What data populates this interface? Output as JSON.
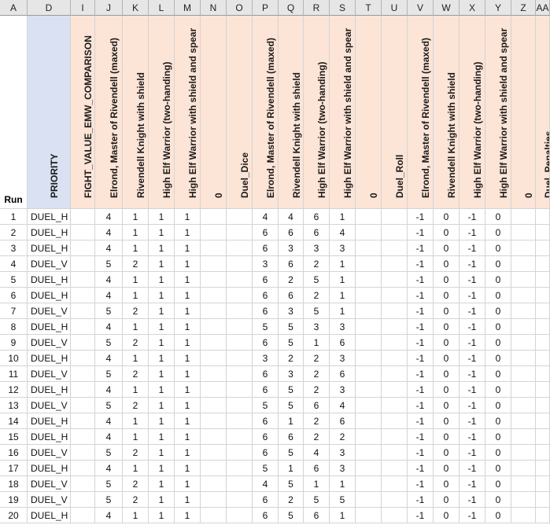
{
  "columns": [
    "A",
    "D",
    "I",
    "J",
    "K",
    "L",
    "M",
    "N",
    "O",
    "P",
    "Q",
    "R",
    "S",
    "T",
    "U",
    "V",
    "W",
    "X",
    "Y",
    "Z",
    "AA"
  ],
  "header_row": {
    "run": "Run",
    "labels": [
      "",
      "PRIORITY",
      "FIGHT_VALUE_EMW_COMPARISON",
      "Elrond, Master of Rivendell (maxed)",
      "Rivendell Knight with shield",
      "High Elf Warrior (two-handing)",
      "High Elf Warrior with shield and spear",
      "0",
      "Duel_Dice",
      "Elrond, Master of Rivendell (maxed)",
      "Rivendell Knight with shield",
      "High Elf Warrior (two-handing)",
      "High Elf Warrior with shield and spear",
      "0",
      "Duel_Roll",
      "Elrond, Master of Rivendell (maxed)",
      "Rivendell Knight with shield",
      "High Elf Warrior (two-handing)",
      "High Elf Warrior with shield and spear",
      "0",
      "Duel_Penalties"
    ]
  },
  "colors": {
    "header_peach": "#fce4d6",
    "header_blue": "#d9e1f2",
    "header_white": "#ffffff",
    "grid": "#d4d4d4",
    "col_header_bg": "#e6e6e6"
  },
  "rows": [
    [
      "1",
      "DUEL_H",
      "",
      "4",
      "1",
      "1",
      "1",
      "",
      "",
      "4",
      "4",
      "6",
      "1",
      "",
      "",
      "-1",
      "0",
      "-1",
      "0",
      "",
      ""
    ],
    [
      "2",
      "DUEL_H",
      "",
      "4",
      "1",
      "1",
      "1",
      "",
      "",
      "6",
      "6",
      "6",
      "4",
      "",
      "",
      "-1",
      "0",
      "-1",
      "0",
      "",
      ""
    ],
    [
      "3",
      "DUEL_H",
      "",
      "4",
      "1",
      "1",
      "1",
      "",
      "",
      "6",
      "3",
      "3",
      "3",
      "",
      "",
      "-1",
      "0",
      "-1",
      "0",
      "",
      ""
    ],
    [
      "4",
      "DUEL_V",
      "",
      "5",
      "2",
      "1",
      "1",
      "",
      "",
      "3",
      "6",
      "2",
      "1",
      "",
      "",
      "-1",
      "0",
      "-1",
      "0",
      "",
      ""
    ],
    [
      "5",
      "DUEL_H",
      "",
      "4",
      "1",
      "1",
      "1",
      "",
      "",
      "6",
      "2",
      "5",
      "1",
      "",
      "",
      "-1",
      "0",
      "-1",
      "0",
      "",
      ""
    ],
    [
      "6",
      "DUEL_H",
      "",
      "4",
      "1",
      "1",
      "1",
      "",
      "",
      "6",
      "6",
      "2",
      "1",
      "",
      "",
      "-1",
      "0",
      "-1",
      "0",
      "",
      ""
    ],
    [
      "7",
      "DUEL_V",
      "",
      "5",
      "2",
      "1",
      "1",
      "",
      "",
      "6",
      "3",
      "5",
      "1",
      "",
      "",
      "-1",
      "0",
      "-1",
      "0",
      "",
      ""
    ],
    [
      "8",
      "DUEL_H",
      "",
      "4",
      "1",
      "1",
      "1",
      "",
      "",
      "5",
      "5",
      "3",
      "3",
      "",
      "",
      "-1",
      "0",
      "-1",
      "0",
      "",
      ""
    ],
    [
      "9",
      "DUEL_V",
      "",
      "5",
      "2",
      "1",
      "1",
      "",
      "",
      "6",
      "5",
      "1",
      "6",
      "",
      "",
      "-1",
      "0",
      "-1",
      "0",
      "",
      ""
    ],
    [
      "10",
      "DUEL_H",
      "",
      "4",
      "1",
      "1",
      "1",
      "",
      "",
      "3",
      "2",
      "2",
      "3",
      "",
      "",
      "-1",
      "0",
      "-1",
      "0",
      "",
      ""
    ],
    [
      "11",
      "DUEL_V",
      "",
      "5",
      "2",
      "1",
      "1",
      "",
      "",
      "6",
      "3",
      "2",
      "6",
      "",
      "",
      "-1",
      "0",
      "-1",
      "0",
      "",
      ""
    ],
    [
      "12",
      "DUEL_H",
      "",
      "4",
      "1",
      "1",
      "1",
      "",
      "",
      "6",
      "5",
      "2",
      "3",
      "",
      "",
      "-1",
      "0",
      "-1",
      "0",
      "",
      ""
    ],
    [
      "13",
      "DUEL_V",
      "",
      "5",
      "2",
      "1",
      "1",
      "",
      "",
      "5",
      "5",
      "6",
      "4",
      "",
      "",
      "-1",
      "0",
      "-1",
      "0",
      "",
      ""
    ],
    [
      "14",
      "DUEL_H",
      "",
      "4",
      "1",
      "1",
      "1",
      "",
      "",
      "6",
      "1",
      "2",
      "6",
      "",
      "",
      "-1",
      "0",
      "-1",
      "0",
      "",
      ""
    ],
    [
      "15",
      "DUEL_H",
      "",
      "4",
      "1",
      "1",
      "1",
      "",
      "",
      "6",
      "6",
      "2",
      "2",
      "",
      "",
      "-1",
      "0",
      "-1",
      "0",
      "",
      ""
    ],
    [
      "16",
      "DUEL_V",
      "",
      "5",
      "2",
      "1",
      "1",
      "",
      "",
      "6",
      "5",
      "4",
      "3",
      "",
      "",
      "-1",
      "0",
      "-1",
      "0",
      "",
      ""
    ],
    [
      "17",
      "DUEL_H",
      "",
      "4",
      "1",
      "1",
      "1",
      "",
      "",
      "5",
      "1",
      "6",
      "3",
      "",
      "",
      "-1",
      "0",
      "-1",
      "0",
      "",
      ""
    ],
    [
      "18",
      "DUEL_V",
      "",
      "5",
      "2",
      "1",
      "1",
      "",
      "",
      "4",
      "5",
      "1",
      "1",
      "",
      "",
      "-1",
      "0",
      "-1",
      "0",
      "",
      ""
    ],
    [
      "19",
      "DUEL_V",
      "",
      "5",
      "2",
      "1",
      "1",
      "",
      "",
      "6",
      "2",
      "5",
      "5",
      "",
      "",
      "-1",
      "0",
      "-1",
      "0",
      "",
      ""
    ],
    [
      "20",
      "DUEL_H",
      "",
      "4",
      "1",
      "1",
      "1",
      "",
      "",
      "6",
      "5",
      "6",
      "1",
      "",
      "",
      "-1",
      "0",
      "-1",
      "0",
      "",
      ""
    ]
  ]
}
